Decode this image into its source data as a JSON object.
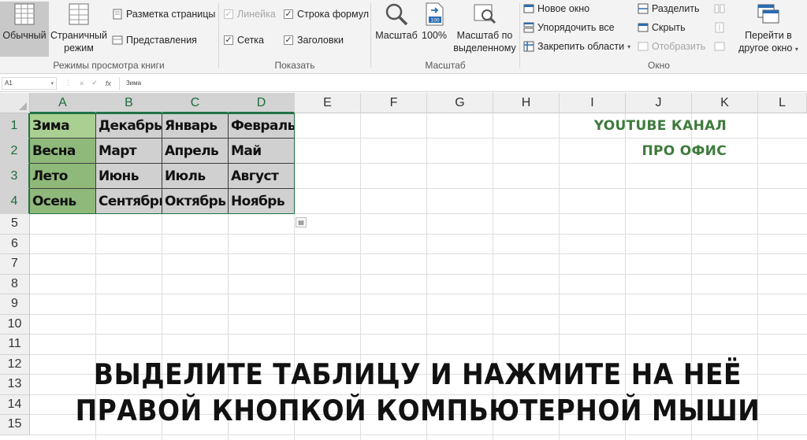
{
  "ribbon": {
    "views": {
      "normal": "Обычный",
      "page_layout_line1": "Страничный",
      "page_layout_line2": "режим",
      "page_markup": "Разметка страницы",
      "representations": "Представления",
      "group_label": "Режимы просмотра книги"
    },
    "show": {
      "ruler": "Линейка",
      "formula_bar": "Строка формул",
      "gridlines": "Сетка",
      "headings": "Заголовки",
      "group_label": "Показать"
    },
    "zoom": {
      "zoom": "Масштаб",
      "hundred": "100%",
      "zoom_selection_line1": "Масштаб по",
      "zoom_selection_line2": "выделенному",
      "group_label": "Масштаб"
    },
    "window": {
      "new_window": "Новое окно",
      "arrange_all": "Упорядочить все",
      "freeze_panes": "Закрепить области",
      "split": "Разделить",
      "hide": "Скрыть",
      "unhide": "Отобразить",
      "switch_line1": "Перейти в",
      "switch_line2": "другое окно",
      "group_label": "Окно"
    }
  },
  "formula_bar": {
    "name_box": "A1",
    "cancel": "×",
    "enter": "✓",
    "fx": "fx",
    "value": "Зима"
  },
  "sheet": {
    "columns": [
      "A",
      "B",
      "C",
      "D",
      "E",
      "F",
      "G",
      "H",
      "I",
      "J",
      "K",
      "L"
    ],
    "rows": [
      "1",
      "2",
      "3",
      "4",
      "5",
      "6",
      "7",
      "8",
      "9",
      "10",
      "11",
      "12",
      "13",
      "14",
      "15"
    ],
    "table": [
      [
        "Зима",
        "Декабрь",
        "Январь",
        "Февраль"
      ],
      [
        "Весна",
        "Март",
        "Апрель",
        "Май"
      ],
      [
        "Лето",
        "Июнь",
        "Июль",
        "Август"
      ],
      [
        "Осень",
        "Сентябрь",
        "Октябрь",
        "Ноябрь"
      ]
    ]
  },
  "overlay": {
    "promo_line1": "YOUTUBE КАНАЛ",
    "promo_line2": "ПРО ОФИС",
    "caption_line1": "ВЫДЕЛИТЕ ТАБЛИЦУ И НАЖМИТЕ НА НЕЁ",
    "caption_line2": "ПРАВОЙ КНОПКОЙ КОМПЬЮТЕРНОЙ МЫШИ"
  },
  "colors": {
    "accent_green": "#217346",
    "season_cell": "#8fb97b",
    "selected_cell": "#a9cf92",
    "month_cell": "#d0d0d0",
    "promo_text": "#3e7b3c"
  }
}
